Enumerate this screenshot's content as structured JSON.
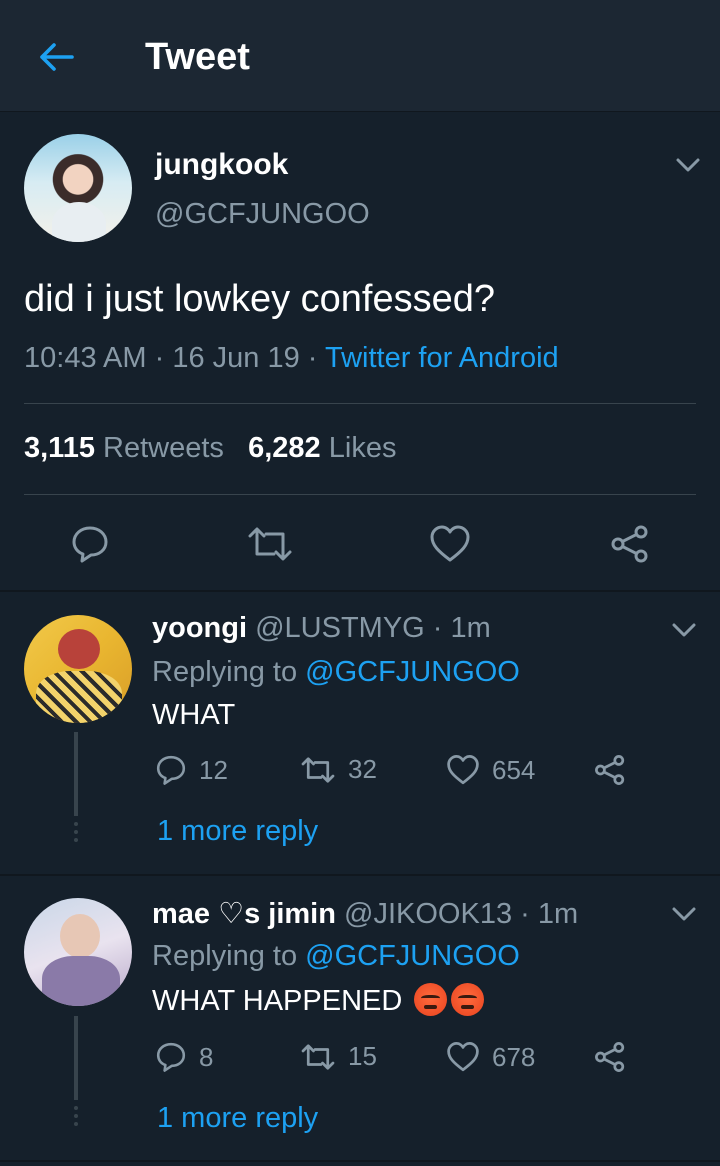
{
  "header": {
    "title": "Tweet",
    "back_icon": "arrow-left-icon"
  },
  "tweet": {
    "name": "jungkook",
    "handle": "@GCFJUNGOO",
    "text": "did i just lowkey confessed?",
    "time": "10:43 AM",
    "date": "16 Jun 19",
    "source": "Twitter for Android",
    "retweets_count": "3,115",
    "retweets_label": "Retweets",
    "likes_count": "6,282",
    "likes_label": "Likes"
  },
  "replies": [
    {
      "name": "yoongi",
      "handle": "@LUSTMYG",
      "time": "1m",
      "replying_label": "Replying to",
      "replying_to": "@GCFJUNGOO",
      "text": "WHAT",
      "reply_count": "12",
      "retweet_count": "32",
      "like_count": "654",
      "more_replies": "1 more reply"
    },
    {
      "name": "mae ♡s jimin",
      "handle": "@JIKOOK13",
      "time": "1m",
      "replying_label": "Replying to",
      "replying_to": "@GCFJUNGOO",
      "text": "WHAT HAPPENED",
      "reply_count": "8",
      "retweet_count": "15",
      "like_count": "678",
      "more_replies": "1 more reply"
    }
  ],
  "colors": {
    "background": "#15202b",
    "header": "#1c2733",
    "accent": "#1da1f2",
    "muted": "#8899a6",
    "divider": "#38444d"
  }
}
